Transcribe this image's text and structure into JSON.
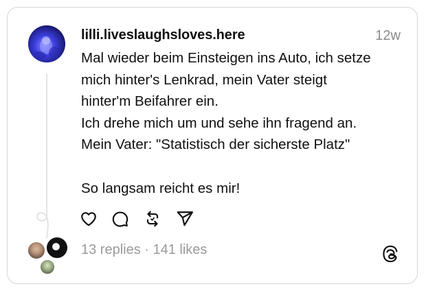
{
  "post": {
    "username": "lilli.liveslaughsloves.here",
    "timestamp": "12w",
    "text": "Mal wieder beim Einsteigen ins Auto, ich setze\nmich hinter's Lenkrad, mein Vater steigt\nhinter'm Beifahrer ein.\nIch drehe mich um und sehe ihn fragend an.\nMein Vater: \"Statistisch der sicherste Platz\"\n\nSo langsam reicht es mir!",
    "stats": "13 replies · 141 likes"
  },
  "actions": [
    {
      "icon": "heart-icon"
    },
    {
      "icon": "comment-icon"
    },
    {
      "icon": "repost-icon"
    },
    {
      "icon": "share-icon"
    }
  ],
  "colors": {
    "text": "#101010",
    "muted": "#9a9a9a",
    "border": "#d6d6d6",
    "thread_line": "#e3e3e3"
  }
}
